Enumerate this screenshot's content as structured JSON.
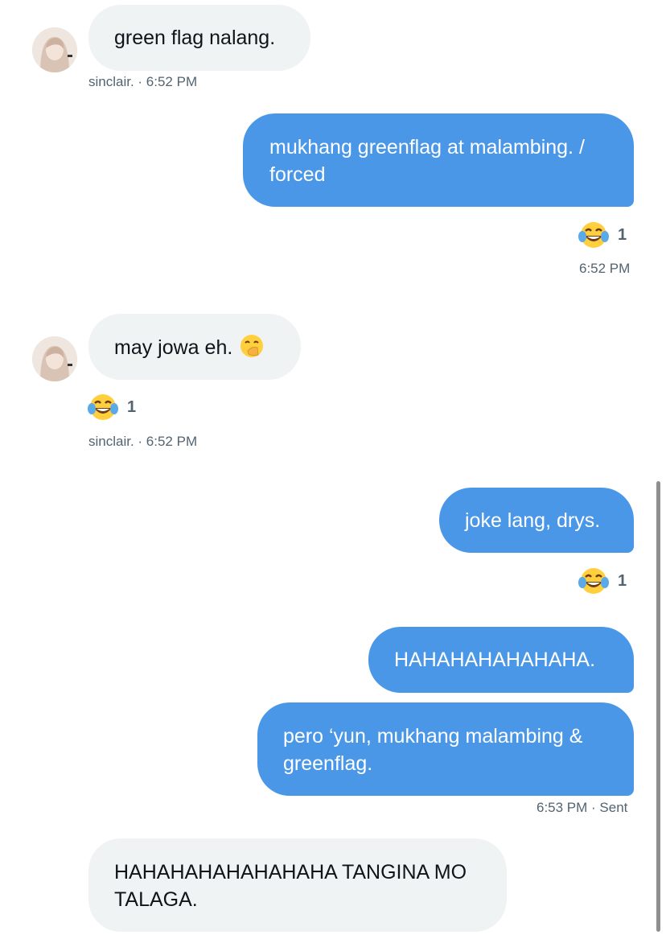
{
  "messages": [
    {
      "text": "green flag nalang."
    },
    {
      "text": "mukhang greenflag at malambing. / forced"
    },
    {
      "text": "may jowa eh."
    },
    {
      "text": "joke lang, drys."
    },
    {
      "text": "HAHAHAHAHAHAHA."
    },
    {
      "text": "pero ‘yun, mukhang malambing & greenflag."
    },
    {
      "text": "HAHAHAHAHAHAHAHA TANGINA MO TALAGA."
    }
  ],
  "meta": {
    "m1": "sinclair. · 6:52 PM",
    "m2": "6:52 PM",
    "m3": "sinclair. · 6:52 PM",
    "m6": "6:53 PM · Sent"
  },
  "reactions": {
    "r2": "1",
    "r3": "1",
    "r4": "1"
  },
  "icons": {
    "reaction": "face-with-tears-of-joy-icon",
    "inline": "face-with-hand-over-mouth-icon",
    "avatar": "user-avatar"
  },
  "colors": {
    "outgoing_bubble": "#4a97e8",
    "incoming_bubble": "#eff3f4",
    "meta_text": "#536471"
  }
}
